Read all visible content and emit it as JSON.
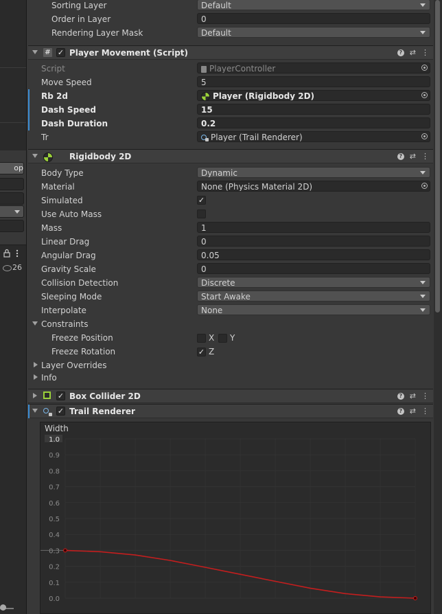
{
  "left_panel": {
    "button_label": "op",
    "count": "26"
  },
  "inspector": {
    "sorting_layer": {
      "label": "Sorting Layer",
      "value": "Default"
    },
    "order_in_layer": {
      "label": "Order in Layer",
      "value": "0"
    },
    "rendering_layer_mask": {
      "label": "Rendering Layer Mask",
      "value": "Default"
    },
    "player_movement": {
      "title": "Player Movement (Script)",
      "enabled": true,
      "fields": {
        "script": {
          "label": "Script",
          "value": "PlayerController"
        },
        "move_speed": {
          "label": "Move Speed",
          "value": "5"
        },
        "rb_2d": {
          "label": "Rb 2d",
          "value": "Player (Rigidbody 2D)"
        },
        "dash_speed": {
          "label": "Dash Speed",
          "value": "15"
        },
        "dash_duration": {
          "label": "Dash Duration",
          "value": "0.2"
        },
        "tr": {
          "label": "Tr",
          "value": "Player (Trail Renderer)"
        }
      }
    },
    "rigidbody": {
      "title": "Rigidbody 2D",
      "fields": {
        "body_type": {
          "label": "Body Type",
          "value": "Dynamic"
        },
        "material": {
          "label": "Material",
          "value": "None (Physics Material 2D)"
        },
        "simulated": {
          "label": "Simulated",
          "checked": true
        },
        "use_auto_mass": {
          "label": "Use Auto Mass",
          "checked": false
        },
        "mass": {
          "label": "Mass",
          "value": "1"
        },
        "linear_drag": {
          "label": "Linear Drag",
          "value": "0"
        },
        "angular_drag": {
          "label": "Angular Drag",
          "value": "0.05"
        },
        "gravity_scale": {
          "label": "Gravity Scale",
          "value": "0"
        },
        "collision_detection": {
          "label": "Collision Detection",
          "value": "Discrete"
        },
        "sleeping_mode": {
          "label": "Sleeping Mode",
          "value": "Start Awake"
        },
        "interpolate": {
          "label": "Interpolate",
          "value": "None"
        }
      },
      "constraints": {
        "label": "Constraints",
        "freeze_position": {
          "label": "Freeze Position",
          "x": "X",
          "y": "Y",
          "x_checked": false,
          "y_checked": false
        },
        "freeze_rotation": {
          "label": "Freeze Rotation",
          "z": "Z",
          "z_checked": true
        }
      },
      "layer_overrides": "Layer Overrides",
      "info": "Info"
    },
    "box_collider": {
      "title": "Box Collider 2D",
      "enabled": true
    },
    "trail_renderer": {
      "title": "Trail Renderer",
      "enabled": true,
      "width_label": "Width",
      "y_ticks": [
        "1.0",
        "0.9",
        "0.8",
        "0.7",
        "0.6",
        "0.5",
        "0.4",
        "0.3",
        "0.2",
        "0.1",
        "0.0"
      ]
    }
  },
  "chart_data": {
    "type": "line",
    "title": "Width",
    "ylim": [
      0,
      1.0
    ],
    "xlim": [
      0,
      1
    ],
    "y_ticks": [
      1.0,
      0.9,
      0.8,
      0.7,
      0.6,
      0.5,
      0.4,
      0.3,
      0.2,
      0.1,
      0.0
    ],
    "grid": true,
    "series": [
      {
        "color": "#c41e1e",
        "keys": [
          {
            "x": 0.0,
            "y": 0.3
          },
          {
            "x": 1.0,
            "y": 0.0
          }
        ],
        "x": [
          0.0,
          0.1,
          0.2,
          0.3,
          0.4,
          0.5,
          0.6,
          0.7,
          0.8,
          0.9,
          1.0
        ],
        "y": [
          0.3,
          0.292,
          0.271,
          0.237,
          0.194,
          0.15,
          0.106,
          0.063,
          0.029,
          0.008,
          0.0
        ]
      }
    ]
  }
}
